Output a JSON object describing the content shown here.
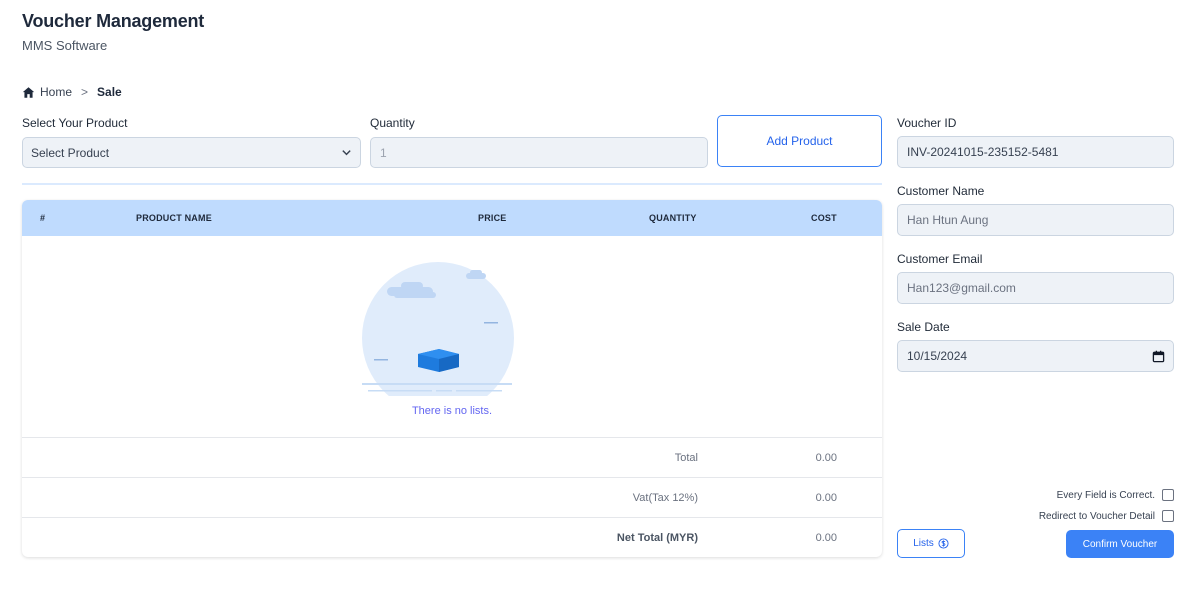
{
  "header": {
    "title": "Voucher Management",
    "subtitle": "MMS Software"
  },
  "breadcrumb": {
    "home": "Home",
    "separator": ">",
    "current": "Sale"
  },
  "product_form": {
    "product_label": "Select Your Product",
    "product_value": "Select Product",
    "quantity_label": "Quantity",
    "quantity_value": "1",
    "add_button": "Add Product"
  },
  "table": {
    "columns": [
      "#",
      "PRODUCT NAME",
      "PRICE",
      "QUANTITY",
      "COST"
    ],
    "empty_text": "There is no lists.",
    "summary": [
      {
        "label": "Total",
        "value": "0.00"
      },
      {
        "label": "Vat(Tax 12%)",
        "value": "0.00"
      },
      {
        "label": "Net Total (MYR)",
        "value": "0.00"
      }
    ]
  },
  "voucher": {
    "id_label": "Voucher ID",
    "id_value": "INV-20241015-235152-5481",
    "name_label": "Customer Name",
    "name_value": "Han Htun Aung",
    "email_label": "Customer Email",
    "email_value": "Han123@gmail.com",
    "date_label": "Sale Date",
    "date_value": "10/15/2024"
  },
  "checks": {
    "correct": "Every Field is Correct.",
    "redirect": "Redirect to Voucher Detail"
  },
  "actions": {
    "lists": "Lists",
    "confirm": "Confirm Voucher"
  },
  "colors": {
    "accent": "#3b82f6",
    "table_header": "#bfdbfe",
    "input_bg": "#eef2f7"
  }
}
